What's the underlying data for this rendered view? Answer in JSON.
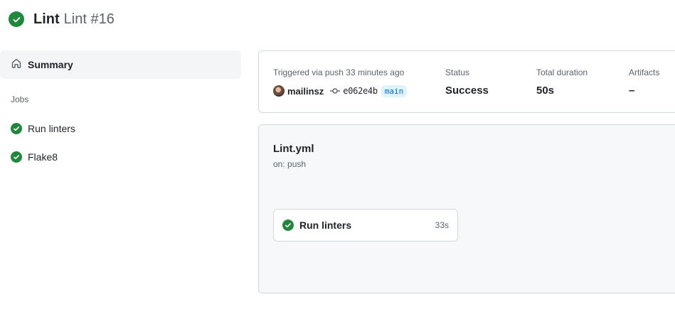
{
  "header": {
    "workflow_name": "Lint",
    "run_title": "Lint #16",
    "status_icon": "check-circle-fill-icon"
  },
  "sidebar": {
    "summary_label": "Summary",
    "jobs_heading": "Jobs",
    "jobs": [
      {
        "label": "Run linters",
        "status": "success"
      },
      {
        "label": "Flake8",
        "status": "success"
      }
    ]
  },
  "summary": {
    "triggered_text": "Triggered via push 33 minutes ago",
    "author": "mailinsz",
    "commit_sha": "e062e4b",
    "branch": "main",
    "status_label": "Status",
    "status_value": "Success",
    "duration_label": "Total duration",
    "duration_value": "50s",
    "artifacts_label": "Artifacts",
    "artifacts_value": "–"
  },
  "graph": {
    "workflow_file": "Lint.yml",
    "trigger": "on: push",
    "jobs": [
      {
        "label": "Run linters",
        "duration": "33s",
        "status": "success"
      }
    ]
  },
  "colors": {
    "success": "#1f883d",
    "link": "#0969da",
    "muted": "#59636e",
    "border": "#d1d9e0"
  }
}
